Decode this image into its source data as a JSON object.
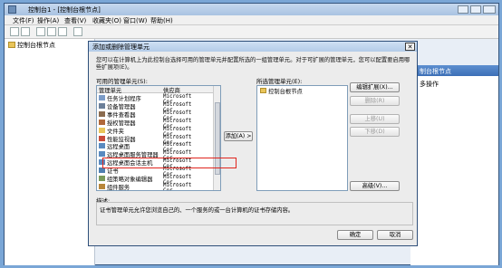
{
  "window": {
    "title": "控制台1 - [控制台根节点]",
    "menu": [
      "文件(F)",
      "操作(A)",
      "查看(V)",
      "收藏夹(O)",
      "窗口(W)",
      "帮助(H)"
    ]
  },
  "tree": {
    "root_label": "控制台根节点"
  },
  "actions_pane": {
    "header": "制台根节点",
    "item": "多操作"
  },
  "dialog": {
    "title": "添加或删除管理单元",
    "intro": "您可以在计算机上为此控制台选择可用的管理单元并配置所选的一组管理单元。对于可扩展的管理单元，您可以配置要启用哪些扩展项(E)。",
    "available_label": "可用的管理单元(S):",
    "columns": [
      "管理单元",
      "供应商"
    ],
    "available": [
      {
        "name": "任务计划程序",
        "vendor": "Microsoft Cor..."
      },
      {
        "name": "设备管理器",
        "vendor": "Microsoft Cor..."
      },
      {
        "name": "事件查看器",
        "vendor": "Microsoft Cor..."
      },
      {
        "name": "授权管理器",
        "vendor": "Microsoft Cor..."
      },
      {
        "name": "文件夹",
        "vendor": "Microsoft Cor..."
      },
      {
        "name": "性能监视器",
        "vendor": "Microsoft Cor..."
      },
      {
        "name": "远程桌面",
        "vendor": "Microsoft Cor..."
      },
      {
        "name": "远程桌面服务管理器",
        "vendor": "Microsoft Cor..."
      },
      {
        "name": "远程桌面会话主机",
        "vendor": "Microsoft Cor..."
      },
      {
        "name": "证书",
        "vendor": "Microsoft Cor..."
      },
      {
        "name": "组策略对象编辑器",
        "vendor": "Microsoft Cor..."
      },
      {
        "name": "组件服务",
        "vendor": "Microsoft Cor..."
      }
    ],
    "add_button": "添加(A) >",
    "selected_label": "所选管理单元(E):",
    "selected": [
      "控制台根节点"
    ],
    "buttons": {
      "edit_ext": "编辑扩展(X)...",
      "remove": "删除(R)",
      "move_up": "上移(U)",
      "move_down": "下移(D)",
      "advanced": "高级(V)..."
    },
    "desc_label": "描述:",
    "desc": "证书管理单元允许您浏览自己的、一个服务的或一台计算机的证书存储内容。",
    "ok": "确定",
    "cancel": "取消"
  }
}
